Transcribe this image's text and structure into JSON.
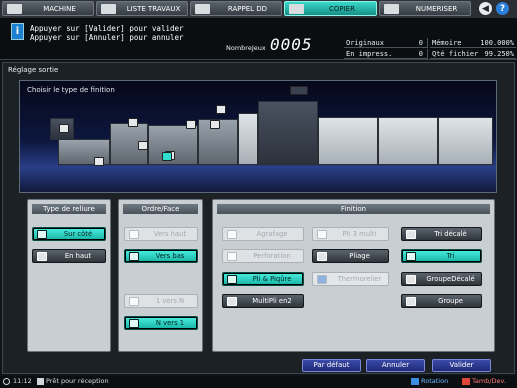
{
  "top_tabs": [
    {
      "label": "MACHINE",
      "icon": "machine-icon"
    },
    {
      "label": "LISTE TRAVAUX",
      "icon": "job-list-icon"
    },
    {
      "label": "RAPPEL DD",
      "icon": "hdd-recall-icon"
    },
    {
      "label": "COPIER",
      "icon": "copy-icon",
      "active": true
    },
    {
      "label": "NUMERISER",
      "icon": "scan-icon"
    }
  ],
  "message": {
    "line1": "Appuyer sur [Valider] pour valider",
    "line2": "Appuyer sur [Annuler] pour annuler"
  },
  "jobs": {
    "label": "NombreJeux",
    "value": "0005"
  },
  "counters": {
    "originals_label": "Originaux",
    "originals_value": "0",
    "printing_label": "En impress.",
    "printing_value": "0",
    "memory_label": "Mémoire",
    "memory_value": "100.000%",
    "file_qty_label": "Qté fichier",
    "file_qty_value": "99.250%"
  },
  "screen_title": "Réglage sortie",
  "finish_prompt": "Choisir le type de finition",
  "binding": {
    "title": "Type de reliure",
    "options": [
      {
        "label": "Sur côté",
        "state": "on"
      },
      {
        "label": "En haut",
        "state": "off"
      }
    ]
  },
  "order": {
    "title": "Ordre/Face",
    "face": [
      {
        "label": "Vers haut",
        "state": "dis"
      },
      {
        "label": "Vers bas",
        "state": "on"
      }
    ],
    "sequence": [
      {
        "label": "1 vers N",
        "state": "dis"
      },
      {
        "label": "N vers 1",
        "state": "on"
      }
    ]
  },
  "finition": {
    "title": "Finition",
    "col1": [
      {
        "label": "Agrafage",
        "state": "dis"
      },
      {
        "label": "Perforation",
        "state": "dis"
      },
      {
        "label": "Pli & Piqûre",
        "state": "on"
      },
      {
        "label": "MultiPli en2",
        "state": "off"
      }
    ],
    "col2": [
      {
        "label": "Pli 3 multi",
        "state": "dis"
      },
      {
        "label": "Pliage",
        "state": "off"
      },
      {
        "label": "Thermorelier",
        "state": "dis"
      }
    ],
    "col3": [
      {
        "label": "Tri décalé",
        "state": "off"
      },
      {
        "label": "Tri",
        "state": "on"
      },
      {
        "label": "GroupeDécalé",
        "state": "off"
      },
      {
        "label": "Groupe",
        "state": "off"
      }
    ]
  },
  "actions": {
    "default": "Par défaut",
    "cancel": "Annuler",
    "validate": "Valider"
  },
  "status": {
    "time": "11:12",
    "ready": "Prêt pour réception",
    "rotation": "Rotation",
    "tamb": "Tamb/Dev."
  }
}
